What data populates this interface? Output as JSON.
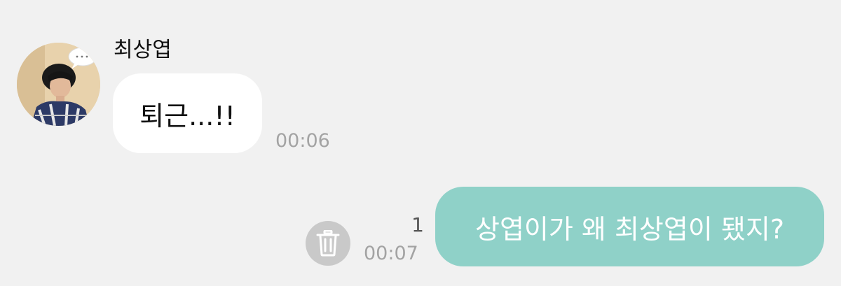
{
  "incoming": {
    "sender_name": "최상엽",
    "message": "퇴근...!!",
    "time": "00:06"
  },
  "outgoing": {
    "message": "상엽이가 왜 최상엽이 됐지?",
    "unread_count": "1",
    "time": "00:07"
  },
  "colors": {
    "background": "#f1f1f1",
    "incoming_bubble": "#ffffff",
    "outgoing_bubble": "#8fd1c8",
    "delete_button": "#c9c9c9"
  },
  "icons": {
    "avatar": "profile-photo",
    "delete": "trash-icon"
  }
}
